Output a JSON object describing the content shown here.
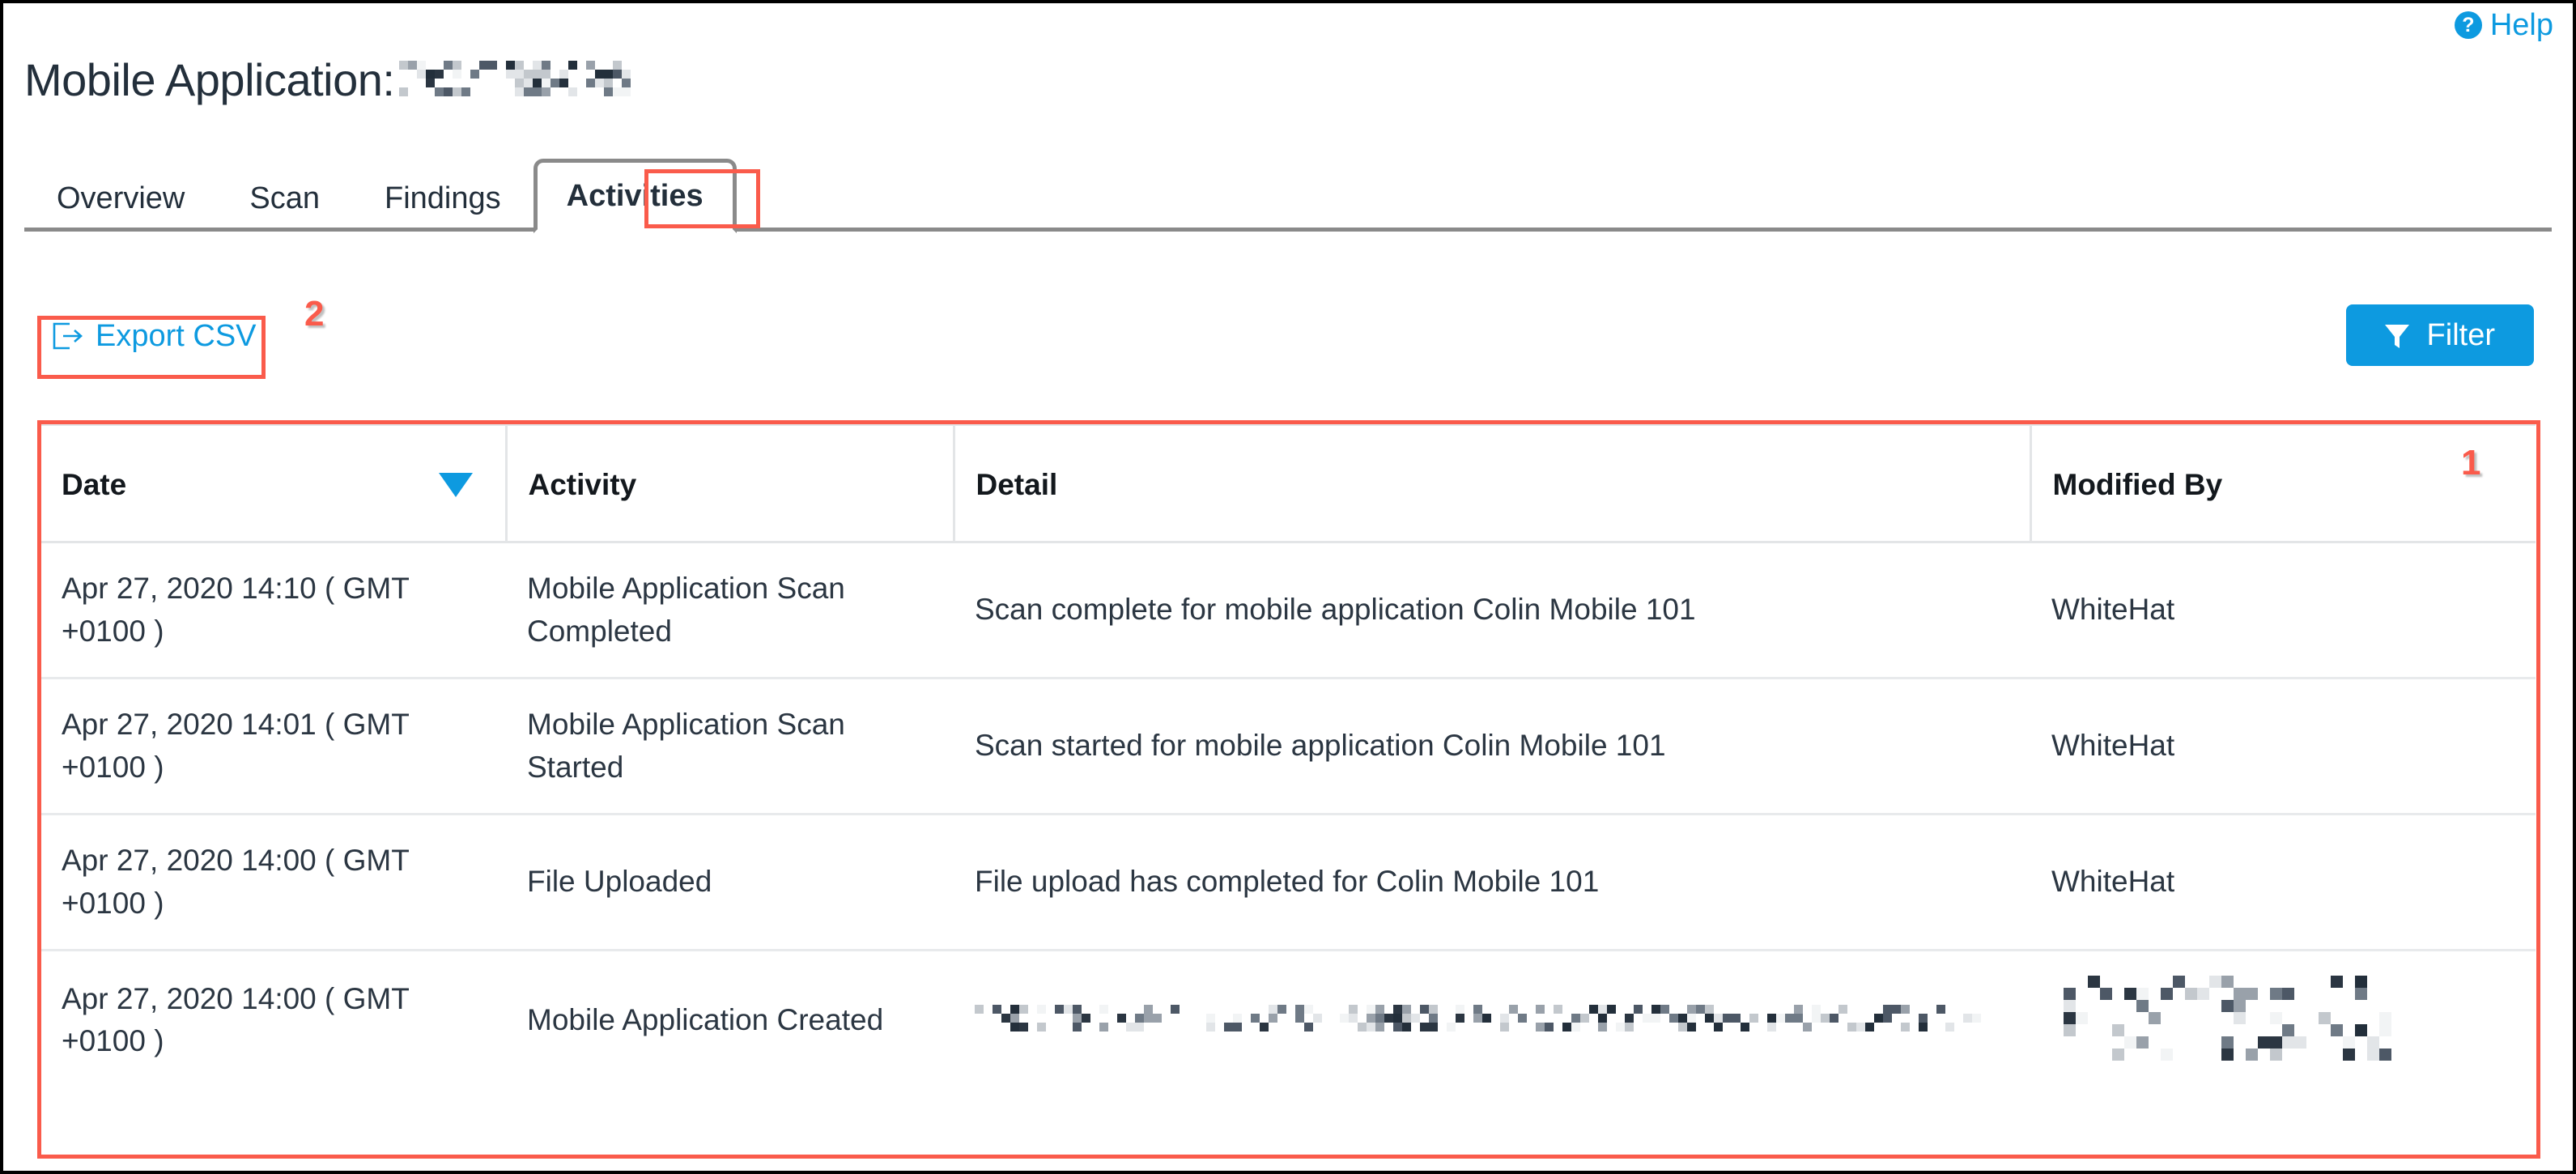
{
  "header": {
    "help_label": "Help",
    "help_icon": "question-circle-icon",
    "title_prefix": "Mobile Application:",
    "title_app_name_redacted": true
  },
  "tabs": [
    {
      "label": "Overview",
      "active": false
    },
    {
      "label": "Scan",
      "active": false
    },
    {
      "label": "Findings",
      "active": false
    },
    {
      "label": "Activities",
      "active": true
    }
  ],
  "toolbar": {
    "export_label": "Export CSV",
    "export_icon": "export-icon",
    "filter_label": "Filter",
    "filter_icon": "funnel-icon"
  },
  "table": {
    "columns": [
      {
        "label": "Date",
        "sort": "desc",
        "sort_icon": "caret-down-icon"
      },
      {
        "label": "Activity",
        "sort": null
      },
      {
        "label": "Detail",
        "sort": null
      },
      {
        "label": "Modified By",
        "sort": null
      }
    ],
    "rows": [
      {
        "date": "Apr 27, 2020 14:10 ( GMT +0100 )",
        "activity": "Mobile Application Scan Completed",
        "detail": "Scan complete for mobile application Colin Mobile 101",
        "modified_by": "WhiteHat",
        "redacted": false
      },
      {
        "date": "Apr 27, 2020 14:01 ( GMT +0100 )",
        "activity": "Mobile Application Scan Started",
        "detail": "Scan started for mobile application Colin Mobile 101",
        "modified_by": "WhiteHat",
        "redacted": false
      },
      {
        "date": "Apr 27, 2020 14:00 ( GMT +0100 )",
        "activity": "File Uploaded",
        "detail": "File upload has completed for Colin Mobile 101",
        "modified_by": "WhiteHat",
        "redacted": false
      },
      {
        "date": "Apr 27, 2020 14:00 ( GMT +0100 )",
        "activity": "Mobile Application Created",
        "detail": "",
        "modified_by": "",
        "redacted": true
      }
    ]
  },
  "annotations": [
    {
      "id": "1",
      "target": "activities-table"
    },
    {
      "id": "2",
      "target": "export-csv-link"
    }
  ],
  "colors": {
    "accent_blue": "#0d9ae0",
    "annotation_red": "#fa5b4b",
    "text_dark": "#232f3b",
    "border_gray": "#e3e5e7",
    "tab_border": "#8a8a8a"
  }
}
